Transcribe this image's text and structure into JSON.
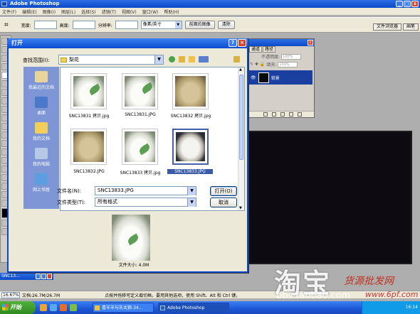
{
  "app": {
    "title": "Adobe Photoshop",
    "menu": [
      "文件(F)",
      "编辑(E)",
      "图像(I)",
      "图层(L)",
      "选择(S)",
      "滤镜(T)",
      "视图(V)",
      "窗口(W)",
      "帮助(H)"
    ],
    "options_bar": {
      "width_label": "宽度:",
      "height_label": "高度:",
      "resolution_label": "分辨率:",
      "unit": "像素/英寸",
      "front_image_button": "前面的图像",
      "clear_button": "清除"
    },
    "panel_tabs": [
      "文件浏览器",
      "画笔"
    ]
  },
  "layers_panel": {
    "tabs": [
      "通道",
      "路径"
    ],
    "opacity_label": "不透明度:",
    "opacity_value": "100%",
    "fill_label": "填充:",
    "fill_value": "100%",
    "layer_name": "背景"
  },
  "dialog": {
    "title": "打开",
    "help_button": "?",
    "close_button": "×",
    "look_in_label": "查找范围(I):",
    "look_in_value": "梨花",
    "places": [
      "我最近的文档",
      "桌面",
      "我的文档",
      "我的电脑",
      "网上邻居"
    ],
    "files": [
      {
        "name": "SNC13831 拷贝.jpg",
        "kind": "pillow",
        "selected": false
      },
      {
        "name": "SNC13831.JPG",
        "kind": "pillow",
        "selected": false
      },
      {
        "name": "SNC13832 拷贝.jpg",
        "kind": "burlap",
        "selected": false
      },
      {
        "name": "SNC13832.JPG",
        "kind": "burlap",
        "selected": false
      },
      {
        "name": "SNC13833 拷贝.jpg",
        "kind": "pillow",
        "selected": false
      },
      {
        "name": "SNC13833.JPG",
        "kind": "dark",
        "selected": true
      }
    ],
    "filename_label": "文件名(N):",
    "filename_value": "SNC13833.JPG",
    "filetype_label": "文件类型(T):",
    "filetype_value": "所有格式",
    "open_button": "打开(O)",
    "cancel_button": "取消",
    "preview_caption": "文件大小: 4.0M"
  },
  "document": {
    "tab_title": "SNC13...",
    "zoom": "16.67%",
    "doc_info": "文档:26.7M/26.7M",
    "status_hint": "点按并拖移可定义裁切框。要用其他选项，使用 Shift、Alt 和 Ctrl 键。"
  },
  "taskbar": {
    "start": "开始",
    "tasks": [
      "喜羊羊与灰太狼-34...",
      "Adobe Photoshop"
    ],
    "clock": "16:14"
  },
  "watermarks": {
    "taobao": "淘宝",
    "source": "货源批发网",
    "url_1": "bbs.taobao.com",
    "url_2": "www.6pf.com"
  }
}
